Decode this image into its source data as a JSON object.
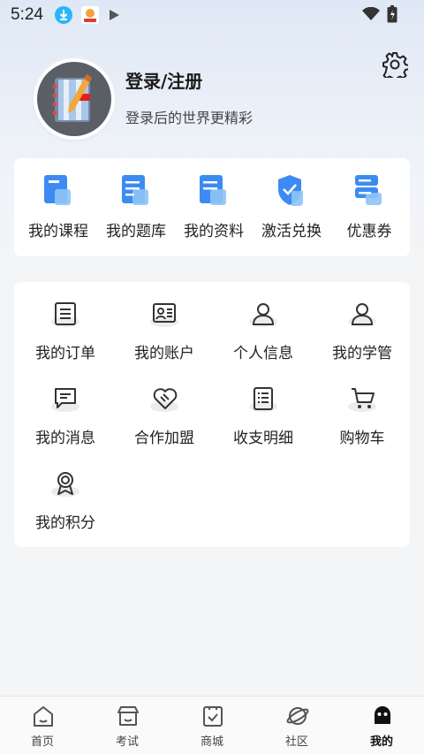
{
  "status_bar": {
    "time": "5:24"
  },
  "profile": {
    "login_label": "登录/注册",
    "subtitle": "登录后的世界更精彩"
  },
  "quick_actions": [
    {
      "label": "我的课程",
      "icon": "course-icon"
    },
    {
      "label": "我的题库",
      "icon": "question-bank-icon"
    },
    {
      "label": "我的资料",
      "icon": "materials-icon"
    },
    {
      "label": "激活兑换",
      "icon": "activate-shield-icon"
    },
    {
      "label": "优惠券",
      "icon": "coupon-icon"
    }
  ],
  "menu": [
    {
      "label": "我的订单",
      "icon": "order-icon"
    },
    {
      "label": "我的账户",
      "icon": "account-card-icon"
    },
    {
      "label": "个人信息",
      "icon": "person-icon"
    },
    {
      "label": "我的学管",
      "icon": "study-manager-icon"
    },
    {
      "label": "我的消息",
      "icon": "message-icon"
    },
    {
      "label": "合作加盟",
      "icon": "handshake-heart-icon"
    },
    {
      "label": "收支明细",
      "icon": "ledger-icon"
    },
    {
      "label": "购物车",
      "icon": "cart-icon"
    },
    {
      "label": "我的积分",
      "icon": "award-icon"
    }
  ],
  "bottom_nav": [
    {
      "label": "首页",
      "icon": "home-icon"
    },
    {
      "label": "考试",
      "icon": "store-exam-icon"
    },
    {
      "label": "商城",
      "icon": "bag-check-icon"
    },
    {
      "label": "社区",
      "icon": "planet-icon"
    },
    {
      "label": "我的",
      "icon": "profile-ghost-icon",
      "active": true
    }
  ],
  "colors": {
    "accent_blue": "#3d8bf2",
    "light_blue": "#8ec3f7"
  }
}
